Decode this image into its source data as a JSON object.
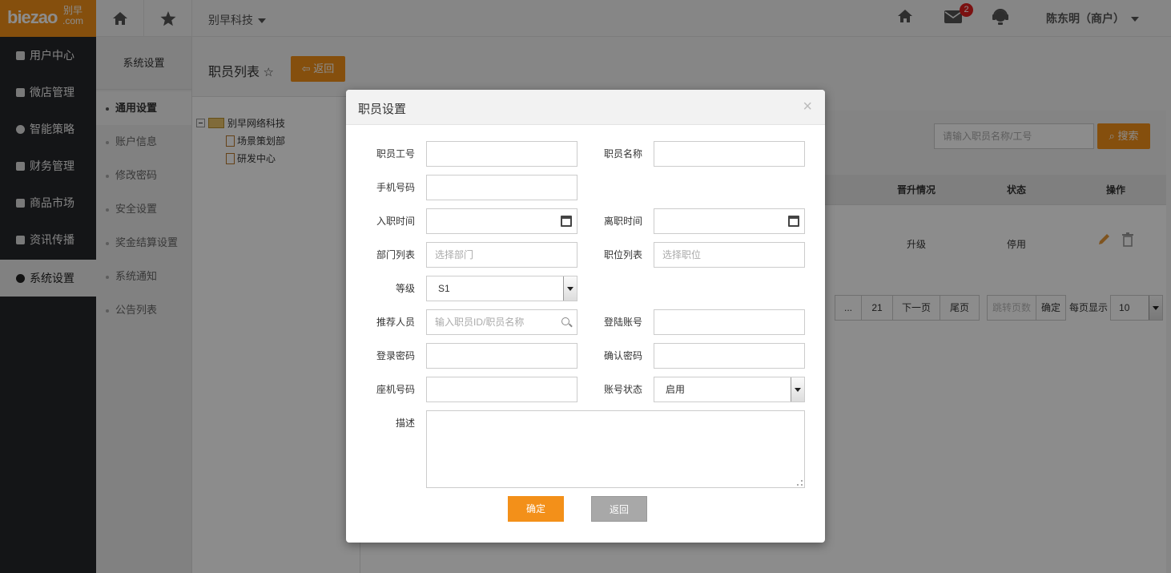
{
  "logo": {
    "brand": "biezao",
    "cn_top": "别早",
    "cn_bottom": ".com"
  },
  "topbar": {
    "company": "别早科技",
    "mail_badge": "2",
    "user": "陈东明（商户）",
    "icons": [
      "home-icon",
      "star-icon",
      "mail-icon",
      "support-icon"
    ]
  },
  "sidebar": {
    "items": [
      {
        "label": "用户中心"
      },
      {
        "label": "微店管理"
      },
      {
        "label": "智能策略"
      },
      {
        "label": "财务管理"
      },
      {
        "label": "商品市场"
      },
      {
        "label": "资讯传播"
      },
      {
        "label": "系统设置"
      }
    ],
    "active_index": 6
  },
  "subnav": {
    "title": "系统设置",
    "items": [
      {
        "label": "通用设置"
      },
      {
        "label": "账户信息"
      },
      {
        "label": "修改密码"
      },
      {
        "label": "安全设置"
      },
      {
        "label": "奖金结算设置"
      },
      {
        "label": "系统通知"
      },
      {
        "label": "公告列表"
      }
    ],
    "active_index": 0
  },
  "main": {
    "title": "职员列表",
    "back_label": "返回",
    "tree": {
      "root": "别早网络科技",
      "children": [
        "场景策划部",
        "研发中心"
      ]
    },
    "search": {
      "placeholder": "请输入职员名称/工号",
      "button": "搜索"
    },
    "table": {
      "headers": [
        "晋升情况",
        "状态",
        "操作"
      ],
      "row": {
        "promotion": "升级",
        "status": "停用"
      }
    },
    "pagination": {
      "ellipsis": "...",
      "last_num": "21",
      "next": "下一页",
      "last": "尾页",
      "jump_placeholder": "跳转页数",
      "confirm": "确定",
      "per_page_label": "每页显示",
      "per_page_value": "10"
    }
  },
  "modal": {
    "title": "职员设置",
    "close": "×",
    "labels": {
      "emp_no": "职员工号",
      "emp_name": "职员名称",
      "phone": "手机号码",
      "join_date": "入职时间",
      "leave_date": "离职时间",
      "dept": "部门列表",
      "position": "职位列表",
      "level": "等级",
      "referrer": "推荐人员",
      "login_account": "登陆账号",
      "login_password": "登录密码",
      "confirm_password": "确认密码",
      "landline": "座机号码",
      "account_status": "账号状态",
      "description": "描述"
    },
    "placeholders": {
      "dept": "选择部门",
      "position": "选择职位",
      "referrer": "输入职员ID/职员名称"
    },
    "values": {
      "level": "S1",
      "account_status": "启用"
    },
    "buttons": {
      "ok": "确定",
      "back": "返回"
    }
  }
}
